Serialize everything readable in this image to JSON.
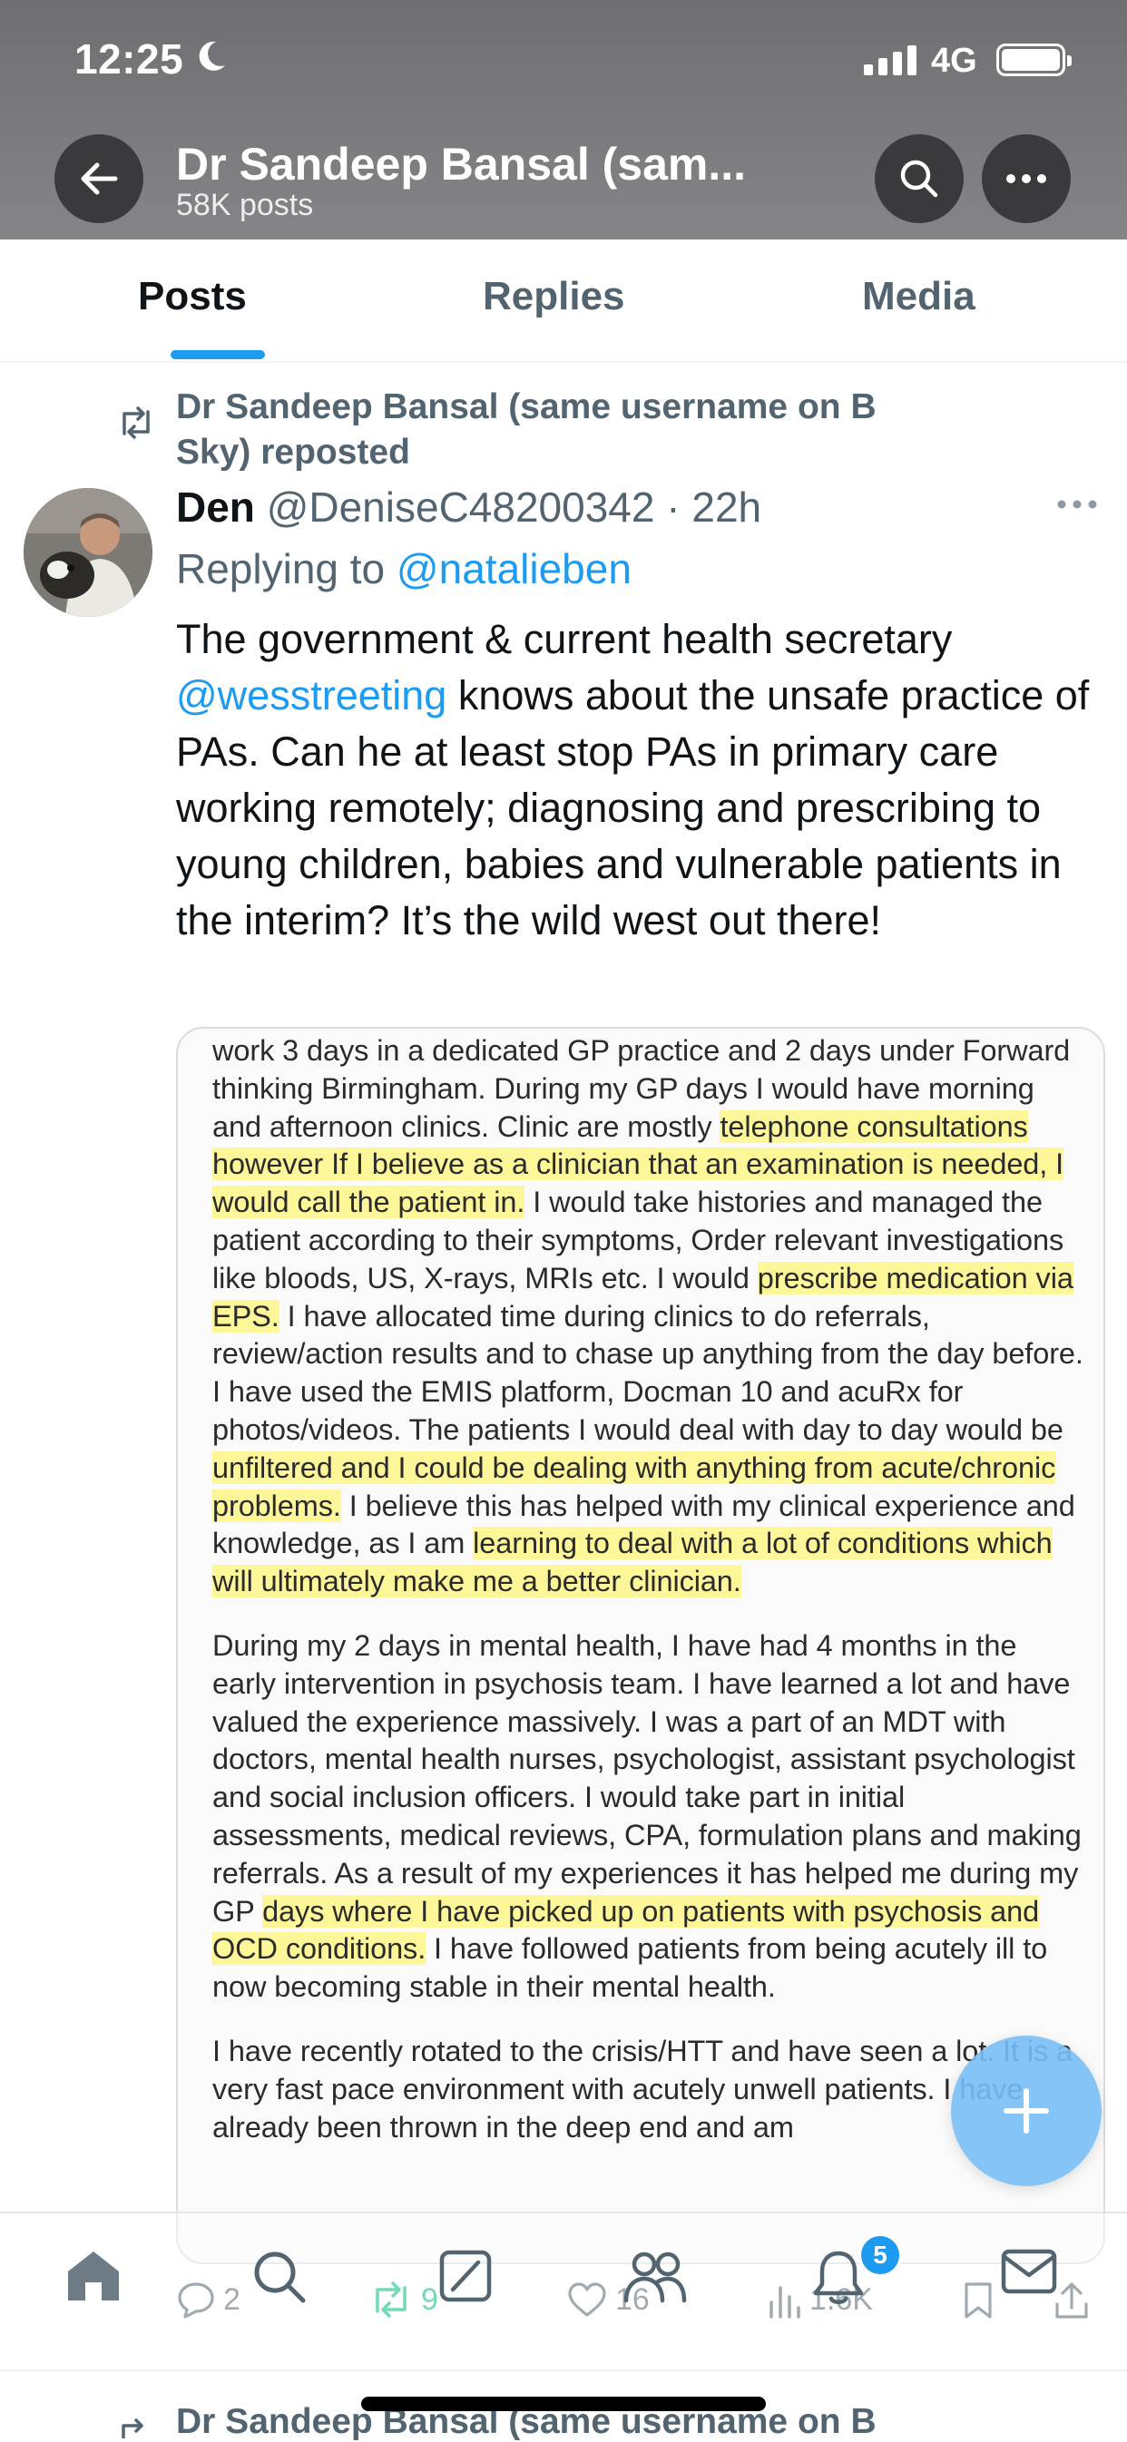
{
  "status_bar": {
    "time": "12:25",
    "network": "4G"
  },
  "nav": {
    "title": "Dr Sandeep Bansal (sam...",
    "subtitle": "58K posts"
  },
  "tabs": [
    {
      "label": "Posts",
      "active": true
    },
    {
      "label": "Replies",
      "active": false
    },
    {
      "label": "Media",
      "active": false
    }
  ],
  "tweet": {
    "repost_line1": "Dr Sandeep Bansal (same username on B",
    "repost_line2": "Sky) reposted",
    "author_name": "Den",
    "author_handle": "@DeniseC48200342",
    "separator": " · ",
    "time": "22h",
    "replying_prefix": "Replying to ",
    "replying_to": "@natalieben",
    "text_line1": "The government & current health secretary",
    "text_mention": "@wesstreeting",
    "text_rest": " knows about the unsafe practice of PAs. Can he at least stop PAs in primary care working remotely; diagnosing and prescribing to young children, babies and vulnerable patients in the interim? It’s the wild west out there!",
    "image_text": {
      "p1_a": "work 3 days in a dedicated GP practice and 2 days under Forward thinking Birmingham. During my GP days I would have morning and afternoon clinics. Clinic are mostly ",
      "p1_hl1": "telephone consultations however If I believe as a clinician that an examination is needed, I would call the patient in.",
      "p1_b": " I would take histories and managed the patient according to their symptoms, Order relevant investigations like bloods, US, X-rays, MRIs etc. I would ",
      "p1_hl2": "prescribe medication via EPS.",
      "p1_c": " I have allocated time during clinics to do referrals, review/action results and to chase up anything from the day before. I have used the EMIS platform, Docman 10 and acuRx for photos/videos. The patients I would deal with day to day would be ",
      "p1_hl3": "unfiltered and I could be dealing with anything from acute/chronic problems.",
      "p1_d": " I believe this has helped with my clinical experience and knowledge, as I am ",
      "p1_hl4": "learning to deal with a lot of conditions which will ultimately make me a better clinician.",
      "p2_a": "During my 2 days in mental health, I have had 4 months in the early intervention in psychosis team. I have learned a lot and have valued the experience massively. I was a part of an MDT with doctors, mental health nurses, psychologist, assistant psychologist and social inclusion officers. I would take part in initial assessments, medical reviews, CPA, formulation plans and making referrals. As a result of my experiences it has helped me during my GP ",
      "p2_hl": "days where I have picked up on patients with psychosis and OCD conditions.",
      "p2_b": " I have followed patients from being acutely ill to now becoming stable in their mental health.",
      "p3": "I have recently rotated to the crisis/HTT and have seen a lot. It is a very fast pace environment with acutely unwell patients. I have already been thrown in the deep end and am"
    },
    "stats": {
      "replies": "2",
      "reposts": "9",
      "likes": "16",
      "views": "1.6K"
    }
  },
  "tabbar": {
    "notification_badge": "5"
  },
  "next_post": {
    "repost_line": "Dr Sandeep Bansal (same username on B"
  },
  "colors": {
    "accent": "#1d9bf0",
    "repost_green": "#00ba7c",
    "secondary_text": "#536471"
  }
}
